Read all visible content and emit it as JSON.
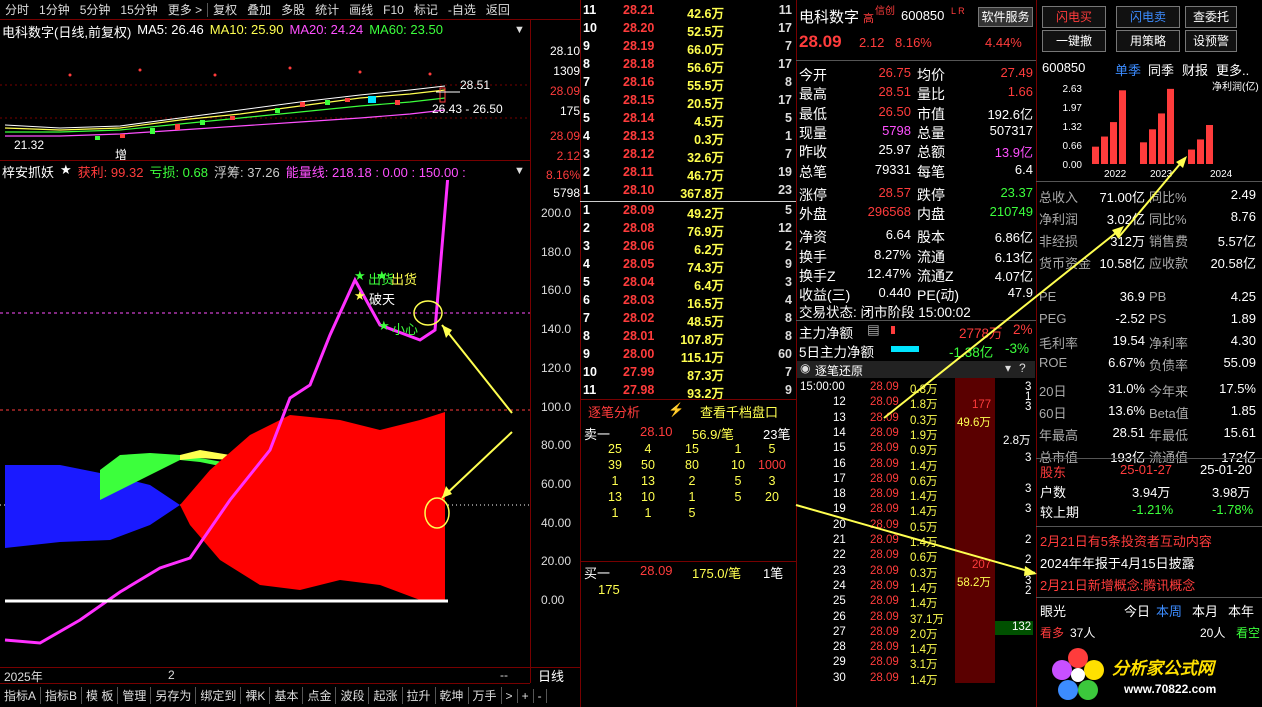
{
  "toolbar": {
    "items": [
      "分时",
      "1分钟",
      "5分钟",
      "15分钟",
      "更多 >",
      "复权",
      "叠加",
      "多股",
      "统计",
      "画线",
      "F10",
      "标记",
      "-自选",
      "返回"
    ]
  },
  "chart_header": {
    "name": "电科数字(日线,前复权)",
    "ma5": "MA5: 26.46",
    "ma10": "MA10: 25.90",
    "ma20": "MA20: 24.24",
    "ma60": "MA60: 23.50"
  },
  "price_axis": [
    "28.10",
    "1309",
    "28.09",
    "175",
    "28.09",
    "2.12",
    "8.16%",
    "5798"
  ],
  "kline_labels": {
    "hi": "28.51",
    "range": "26.43 - 26.50",
    "lo": "21.32",
    "zeng": "增"
  },
  "indicator": {
    "name": "梓安抓妖",
    "profit": "获利: 99.32",
    "loss": "亏损: 0.68",
    "float": "浮筹: 37.26",
    "energy": "能量线: 218.18 : 0.00 : 150.00 :",
    "signals": [
      "出货",
      "出货",
      "破天",
      "小心"
    ]
  },
  "ind_axis": [
    "200.0",
    "180.0",
    "160.0",
    "140.0",
    "120.0",
    "100.0",
    "80.00",
    "60.00",
    "40.00",
    "20.00",
    "0.00"
  ],
  "bottom": {
    "year": "2025年",
    "month": "2",
    "period": "日线",
    "tabs": [
      "指标A",
      "指标B",
      "模 板",
      "管理",
      "另存为",
      "绑定到",
      "裸K",
      "基本",
      "点金",
      "波段",
      "起涨",
      "拉升",
      "乾坤",
      "万手",
      ">",
      "+",
      "-"
    ]
  },
  "order_book": {
    "asks": [
      [
        "11",
        "28.21",
        "42.6万",
        "11"
      ],
      [
        "10",
        "28.20",
        "52.5万",
        "17"
      ],
      [
        "9",
        "28.19",
        "66.0万",
        "7"
      ],
      [
        "8",
        "28.18",
        "56.6万",
        "17"
      ],
      [
        "7",
        "28.16",
        "55.5万",
        "8"
      ],
      [
        "6",
        "28.15",
        "20.5万",
        "17"
      ],
      [
        "5",
        "28.14",
        "4.5万",
        "5"
      ],
      [
        "4",
        "28.13",
        "0.3万",
        "1"
      ],
      [
        "3",
        "28.12",
        "32.6万",
        "7"
      ],
      [
        "2",
        "28.11",
        "46.7万",
        "19"
      ],
      [
        "1",
        "28.10",
        "367.8万",
        "23"
      ]
    ],
    "bids": [
      [
        "1",
        "28.09",
        "49.2万",
        "5"
      ],
      [
        "2",
        "28.08",
        "76.9万",
        "12"
      ],
      [
        "3",
        "28.06",
        "6.2万",
        "2"
      ],
      [
        "4",
        "28.05",
        "74.3万",
        "9"
      ],
      [
        "5",
        "28.04",
        "6.4万",
        "3"
      ],
      [
        "6",
        "28.03",
        "16.5万",
        "4"
      ],
      [
        "7",
        "28.02",
        "48.5万",
        "8"
      ],
      [
        "8",
        "28.01",
        "107.8万",
        "8"
      ],
      [
        "9",
        "28.00",
        "115.1万",
        "60"
      ],
      [
        "10",
        "27.99",
        "87.3万",
        "7"
      ],
      [
        "11",
        "27.98",
        "93.2万",
        "9"
      ]
    ],
    "analysis_tab": "逐笔分析",
    "qianbo_tab": "查看千档盘口",
    "sell1": {
      "label": "卖一",
      "price": "28.10",
      "vol": "56.9/笔",
      "count": "23笔"
    },
    "sell_grid": [
      [
        "25",
        "4",
        "15",
        "1",
        "5"
      ],
      [
        "39",
        "50",
        "80",
        "10",
        "1000"
      ],
      [
        "1",
        "13",
        "2",
        "5",
        "3"
      ],
      [
        "13",
        "10",
        "1",
        "5",
        "20"
      ],
      [
        "1",
        "1",
        "5",
        "",
        ""
      ]
    ],
    "buy1": {
      "label": "买一",
      "price": "28.09",
      "vol": "175.0/笔",
      "count": "1笔"
    },
    "buy_grid": [
      "175"
    ]
  },
  "quote": {
    "name": "电科数字",
    "tag1": "高",
    "tag2": "信创",
    "code": "600850",
    "lr": "L R",
    "price": "28.09",
    "change": "2.12",
    "pct": "8.16%",
    "service": "软件服务",
    "service_pct": "4.44%",
    "rows": [
      [
        "今开",
        "26.75",
        "均价",
        "27.49"
      ],
      [
        "最高",
        "28.51",
        "量比",
        "1.66"
      ],
      [
        "最低",
        "26.50",
        "市值",
        "192.6亿"
      ],
      [
        "现量",
        "5798",
        "总量",
        "507317"
      ],
      [
        "昨收",
        "25.97",
        "总额",
        "13.9亿"
      ],
      [
        "总笔",
        "79331",
        "每笔",
        "6.4"
      ],
      [
        "涨停",
        "28.57",
        "跌停",
        "23.37"
      ],
      [
        "外盘",
        "296568",
        "内盘",
        "210749"
      ],
      [
        "净资",
        "6.64",
        "股本",
        "6.86亿"
      ],
      [
        "换手",
        "8.27%",
        "流通",
        "6.13亿"
      ],
      [
        "换手Z",
        "12.47%",
        "流通Z",
        "4.07亿"
      ],
      [
        "收益(三)",
        "0.440",
        "PE(动)",
        "47.9"
      ]
    ],
    "status": "交易状态: 闭市阶段 15:00:02",
    "main_flow_label": "主力净额",
    "main_flow_val": "2778万",
    "main_flow_pct": "2%",
    "five_day_label": "5日主力净额",
    "five_day_val": "-1.38亿",
    "five_day_pct": "-3%",
    "tick_title": "逐笔还原",
    "tick_time": "15:00:00",
    "ticks": [
      [
        "",
        "28.09",
        "0.8万"
      ],
      [
        "12",
        "28.09",
        "1.8万"
      ],
      [
        "13",
        "28.09",
        "0.3万"
      ],
      [
        "14",
        "28.09",
        "1.9万"
      ],
      [
        "15",
        "28.09",
        "0.9万"
      ],
      [
        "16",
        "28.09",
        "1.4万"
      ],
      [
        "17",
        "28.09",
        "0.6万"
      ],
      [
        "18",
        "28.09",
        "1.4万"
      ],
      [
        "19",
        "28.09",
        "1.4万"
      ],
      [
        "20",
        "28.09",
        "0.5万"
      ],
      [
        "21",
        "28.09",
        "1.4万"
      ],
      [
        "22",
        "28.09",
        "0.6万"
      ],
      [
        "23",
        "28.09",
        "0.3万"
      ],
      [
        "24",
        "28.09",
        "1.4万"
      ],
      [
        "25",
        "28.09",
        "1.4万"
      ],
      [
        "26",
        "28.09",
        "37.1万"
      ],
      [
        "27",
        "28.09",
        "2.0万"
      ],
      [
        "28",
        "28.09",
        "1.4万"
      ],
      [
        "29",
        "28.09",
        "3.1万"
      ],
      [
        "30",
        "28.09",
        "1.4万"
      ]
    ],
    "tick_side": [
      "177",
      "49.6万",
      "207",
      "58.2万",
      "132"
    ],
    "tick_right": [
      "3",
      "1",
      "3",
      "",
      "",
      "2.8万",
      "",
      "3",
      "",
      "",
      "3",
      "",
      "3",
      "",
      "",
      "2",
      "",
      "2",
      "",
      "3",
      "2",
      "",
      "",
      "",
      "",
      "",
      "",
      "",
      "",
      ""
    ]
  },
  "right_panel": {
    "buttons": [
      "闪电买",
      "闪电卖",
      "查委托",
      "一键撤",
      "用策略",
      "设预警"
    ],
    "code": "600850",
    "tabs": [
      "单季",
      "同季",
      "财报",
      "更多.."
    ],
    "chart_title": "净利润(亿)",
    "fin_rows": [
      [
        "总收入",
        "71.00亿",
        "同比%",
        "2.49"
      ],
      [
        "净利润",
        "3.02亿",
        "同比%",
        "8.76"
      ],
      [
        "非经损",
        "312万",
        "销售费",
        "5.57亿"
      ],
      [
        "货币资金",
        "10.58亿",
        "应收款",
        "20.58亿"
      ],
      [
        "PE",
        "36.9",
        "PB",
        "4.25"
      ],
      [
        "PEG",
        "-2.52",
        "PS",
        "1.89"
      ],
      [
        "毛利率",
        "19.54",
        "净利率",
        "4.30"
      ],
      [
        "ROE",
        "6.67%",
        "负债率",
        "55.09"
      ],
      [
        "20日",
        "31.0%",
        "今年来",
        "17.5%"
      ],
      [
        "60日",
        "13.6%",
        "Beta值",
        "1.85"
      ],
      [
        "年最高",
        "28.51",
        "年最低",
        "15.61"
      ],
      [
        "总市值",
        "193亿",
        "流通值",
        "172亿"
      ]
    ],
    "holders": {
      "label": "股东",
      "d1": "25-01-27",
      "d2": "25-01-20"
    },
    "hushu": {
      "label": "户数",
      "v1": "3.94万",
      "v2": "3.98万"
    },
    "prev": {
      "label": "较上期",
      "v1": "-1.21%",
      "v2": "-1.78%"
    },
    "news": [
      "2月21日有5条投资者互动内容",
      "2024年年报于4月15日披露",
      "2月21日新增概念:腾讯概念"
    ],
    "eye": {
      "label": "眼光",
      "t1": "今日",
      "t2": "本周",
      "t3": "本月",
      "t4": "本年"
    },
    "bull": {
      "label": "看多",
      "v": "37人",
      "v2": "20人",
      "bear": "看空"
    },
    "watermark": "分析家公式网",
    "site": "www.70822.com"
  },
  "chart_data": {
    "type": "bar",
    "categories": [
      "2022",
      "2023",
      "2024"
    ],
    "title": "净利润(亿)",
    "ylim": [
      0,
      2.63
    ],
    "yticks": [
      "2.63",
      "1.97",
      "1.32",
      "0.66",
      "0.00"
    ],
    "series": [
      {
        "values": [
          0.6,
          0.95,
          1.45,
          2.55,
          0.75,
          1.2,
          1.75,
          2.6,
          0.5,
          0.85,
          1.35
        ]
      }
    ]
  },
  "colors": {
    "up": "#ff3c3c",
    "down": "#3cff3c",
    "accent": "#ffff50",
    "grid": "#770000"
  }
}
